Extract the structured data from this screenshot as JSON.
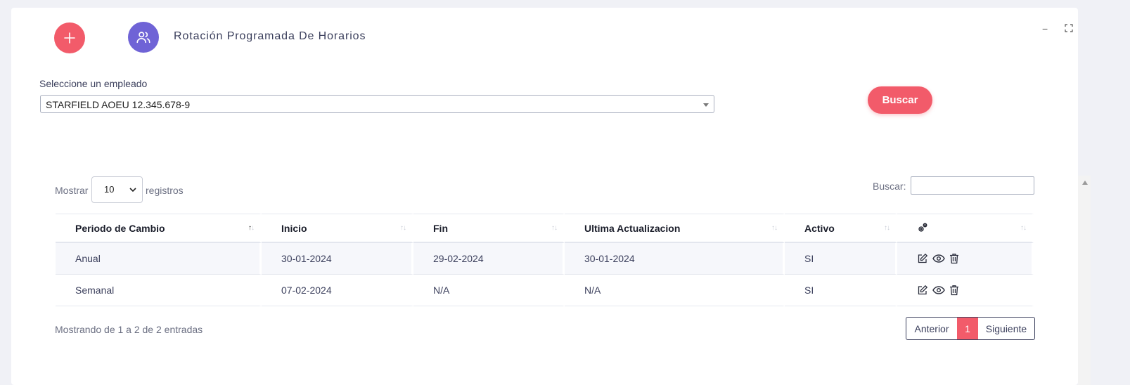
{
  "header": {
    "title": "Rotación Programada De Horarios",
    "add_icon": "plus-icon",
    "users_icon": "users-icon",
    "minimize_symbol": "−",
    "maximize_icon": "fullscreen-icon"
  },
  "employee": {
    "label": "Seleccione un empleado",
    "selected": "STARFIELD AOEU 12.345.678-9"
  },
  "search_button": {
    "label": "Buscar"
  },
  "table_controls": {
    "show_label": "Mostrar",
    "page_length": "10",
    "records_label": "registros",
    "filter_label": "Buscar:",
    "filter_value": ""
  },
  "table": {
    "columns": [
      "Periodo de Cambio",
      "Inicio",
      "Fin",
      "Ultima Actualizacion",
      "Activo",
      ""
    ],
    "actions_header_icon": "gears-icon",
    "rows": [
      {
        "periodo": "Anual",
        "inicio": "30-01-2024",
        "fin": "29-02-2024",
        "actualizacion": "30-01-2024",
        "activo": "SI"
      },
      {
        "periodo": "Semanal",
        "inicio": "07-02-2024",
        "fin": "N/A",
        "actualizacion": "N/A",
        "activo": "SI"
      }
    ],
    "row_action_icons": [
      "edit-icon",
      "view-icon",
      "delete-icon"
    ]
  },
  "footer": {
    "info": "Mostrando de 1 a 2 de 2 entradas",
    "prev": "Anterior",
    "current_page": "1",
    "next": "Siguiente"
  },
  "colors": {
    "accent": "#f25b6a",
    "users_button": "#6f63d6"
  }
}
